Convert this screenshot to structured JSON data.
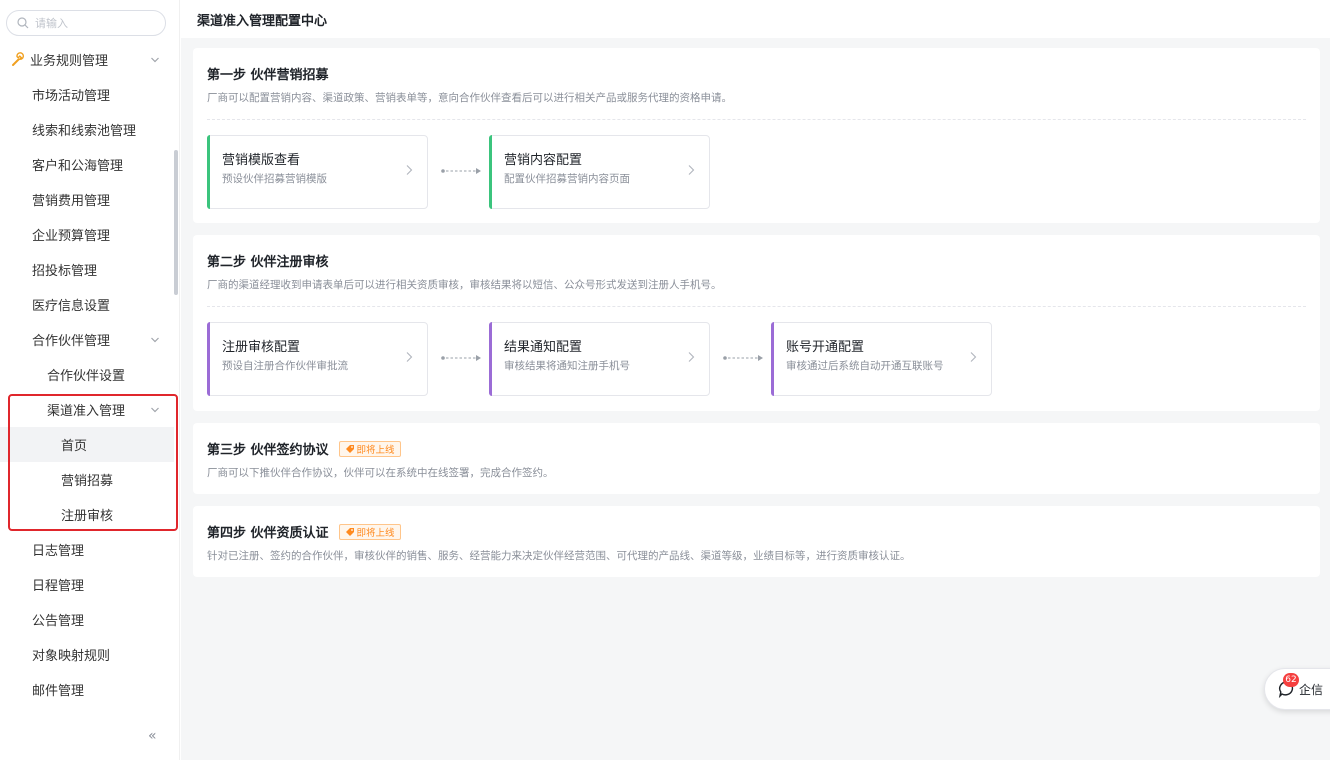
{
  "search": {
    "placeholder": "请输入"
  },
  "sidebar": {
    "root": {
      "label": "业务规则管理"
    },
    "items": [
      {
        "label": "市场活动管理"
      },
      {
        "label": "线索和线索池管理"
      },
      {
        "label": "客户和公海管理"
      },
      {
        "label": "营销费用管理"
      },
      {
        "label": "企业预算管理"
      },
      {
        "label": "招投标管理"
      },
      {
        "label": "医疗信息设置"
      }
    ],
    "partner_group": {
      "label": "合作伙伴管理"
    },
    "partner_settings": {
      "label": "合作伙伴设置"
    },
    "channel_group": {
      "label": "渠道准入管理"
    },
    "channel_items": [
      {
        "label": "首页"
      },
      {
        "label": "营销招募"
      },
      {
        "label": "注册审核"
      }
    ],
    "tail_items": [
      {
        "label": "日志管理"
      },
      {
        "label": "日程管理"
      },
      {
        "label": "公告管理"
      },
      {
        "label": "对象映射规则"
      },
      {
        "label": "邮件管理"
      }
    ],
    "collapse_symbol": "«"
  },
  "header": {
    "title": "渠道准入管理配置中心"
  },
  "steps": [
    {
      "title": "第一步  伙伴营销招募",
      "desc": "厂商可以配置营销内容、渠道政策、营销表单等，意向合作伙伴查看后可以进行相关产品或服务代理的资格申请。",
      "cards": [
        {
          "title": "营销模版查看",
          "desc": "预设伙伴招募营销模版"
        },
        {
          "title": "营销内容配置",
          "desc": "配置伙伴招募营销内容页面"
        }
      ]
    },
    {
      "title": "第二步  伙伴注册审核",
      "desc": "厂商的渠道经理收到申请表单后可以进行相关资质审核，审核结果将以短信、公众号形式发送到注册人手机号。",
      "cards": [
        {
          "title": "注册审核配置",
          "desc": "预设自注册合作伙伴审批流"
        },
        {
          "title": "结果通知配置",
          "desc": "审核结果将通知注册手机号"
        },
        {
          "title": "账号开通配置",
          "desc": "审核通过后系统自动开通互联账号"
        }
      ]
    },
    {
      "title": "第三步  伙伴签约协议",
      "badge": "即将上线",
      "desc": "厂商可以下推伙伴合作协议，伙伴可以在系统中在线签署，完成合作签约。"
    },
    {
      "title": "第四步  伙伴资质认证",
      "badge": "即将上线",
      "desc": "针对已注册、签约的合作伙伴，审核伙伴的销售、服务、经营能力来决定伙伴经营范围、可代理的产品线、渠道等级，业绩目标等，进行资质审核认证。"
    }
  ],
  "chat": {
    "badge_count": "62",
    "label": "企信"
  },
  "colors": {
    "accent_green": "#3bc47d",
    "accent_purple": "#9b6cd6",
    "badge_orange": "#ff8a1f",
    "highlight_red": "#e0262c"
  }
}
